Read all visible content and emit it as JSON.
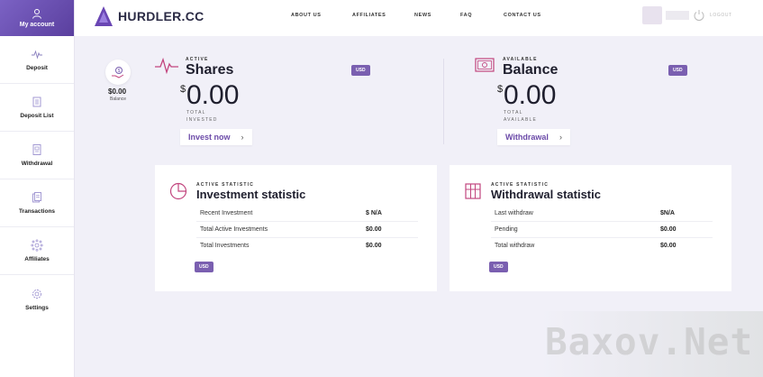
{
  "sidebar": {
    "items": [
      {
        "label": "My account",
        "icon": "user-icon"
      },
      {
        "label": "Deposit",
        "icon": "pulse-icon"
      },
      {
        "label": "Deposit List",
        "icon": "list-icon"
      },
      {
        "label": "Withdrawal",
        "icon": "document-icon"
      },
      {
        "label": "Transactions",
        "icon": "transactions-icon"
      },
      {
        "label": "Affiliates",
        "icon": "network-icon"
      },
      {
        "label": "Settings",
        "icon": "gear-icon"
      }
    ]
  },
  "header": {
    "logo": "HURDLER.CC",
    "nav": [
      "ABOUT US",
      "AFFILIATES",
      "NEWS",
      "FAQ",
      "CONTACT US"
    ],
    "logout": "LOGOUT"
  },
  "summary": {
    "amount": "$0.00",
    "label": "Balance"
  },
  "shares": {
    "cap": "ACTIVE",
    "title": "Shares",
    "badge": "USD",
    "currency": "$",
    "amount": "0.00",
    "sub1": "TOTAL",
    "sub2": "INVESTED",
    "button": "Invest now",
    "chevron": "›"
  },
  "balance": {
    "cap": "AVAILABLE",
    "title": "Balance",
    "badge": "USD",
    "currency": "$",
    "amount": "0.00",
    "sub1": "TOTAL",
    "sub2": "AVAILABLE",
    "button": "Withdrawal",
    "chevron": "›"
  },
  "investment_stat": {
    "cap": "ACTIVE STATISTIC",
    "title": "Investment statistic",
    "badge": "USD",
    "rows": [
      {
        "label": "Recent Investment",
        "value": "$ N/A"
      },
      {
        "label": "Total Active Investments",
        "value": "$0.00"
      },
      {
        "label": "Total Investments",
        "value": "$0.00"
      }
    ]
  },
  "withdrawal_stat": {
    "cap": "ACTIVE STATISTIC",
    "title": "Withdrawal statistic",
    "badge": "USD",
    "rows": [
      {
        "label": "Last withdraw",
        "value": "$N/A"
      },
      {
        "label": "Pending",
        "value": "$0.00"
      },
      {
        "label": "Total withdraw",
        "value": "$0.00"
      }
    ]
  },
  "watermark": "Baxov.Net",
  "colors": {
    "accent": "#6b4aa8",
    "badge": "#7a5fb0",
    "sidebar_active": "#6a50b4",
    "icon_pink": "#c2457e"
  }
}
